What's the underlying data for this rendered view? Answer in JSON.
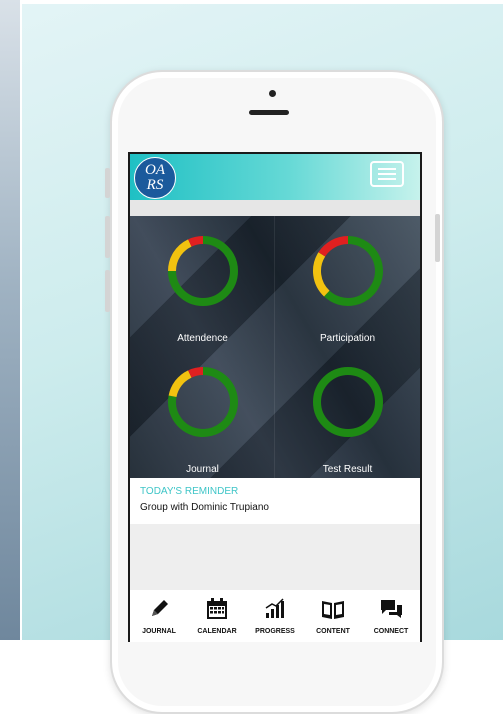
{
  "app": {
    "logo_line1": "OA",
    "logo_line2": "RS",
    "menu_icon": "hamburger-menu-icon",
    "accent_color": "#3ec5c7",
    "header_gradient": [
      "#1fc0c4",
      "#c6f2ec"
    ]
  },
  "dashboard": {
    "tiles": [
      {
        "label": "Attendence",
        "segments": [
          {
            "color": "#1e8a14",
            "fraction": 0.75
          },
          {
            "color": "#f2c210",
            "fraction": 0.18
          },
          {
            "color": "#e02020",
            "fraction": 0.07
          }
        ]
      },
      {
        "label": "Participation",
        "segments": [
          {
            "color": "#1e8a14",
            "fraction": 0.62
          },
          {
            "color": "#f2c210",
            "fraction": 0.22
          },
          {
            "color": "#e02020",
            "fraction": 0.16
          }
        ]
      },
      {
        "label": "Journal",
        "segments": [
          {
            "color": "#1e8a14",
            "fraction": 0.78
          },
          {
            "color": "#f2c210",
            "fraction": 0.15
          },
          {
            "color": "#e02020",
            "fraction": 0.07
          }
        ]
      },
      {
        "label": "Test Result",
        "segments": [
          {
            "color": "#1e8a14",
            "fraction": 1.0
          }
        ]
      }
    ]
  },
  "reminder": {
    "title": "TODAY'S REMINDER",
    "text": "Group with Dominic Trupiano"
  },
  "nav": [
    {
      "label": "JOURNAL",
      "icon": "pencil-icon"
    },
    {
      "label": "CALENDAR",
      "icon": "calendar-icon"
    },
    {
      "label": "PROGRESS",
      "icon": "bar-chart-icon"
    },
    {
      "label": "CONTENT",
      "icon": "book-icon"
    },
    {
      "label": "CONNECT",
      "icon": "chat-bubbles-icon"
    }
  ]
}
